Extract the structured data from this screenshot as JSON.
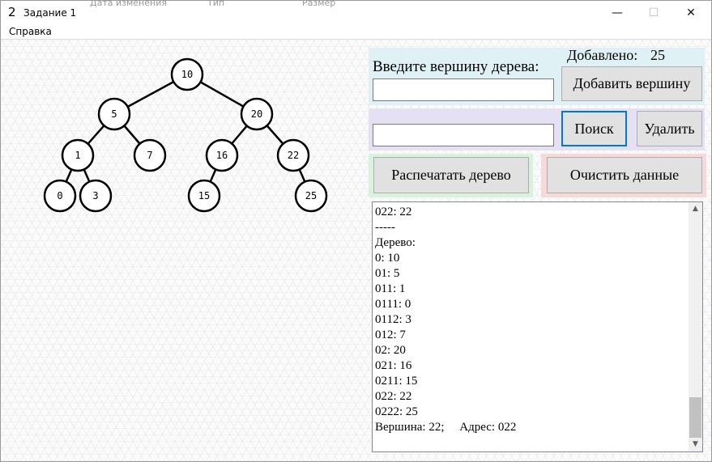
{
  "window": {
    "app_icon_glyph": "2",
    "title": "Задание 1",
    "background_header_text": [
      "Дата изменения",
      "Тип",
      "Размер"
    ],
    "minimize_glyph": "—",
    "maximize_glyph": "☐",
    "close_glyph": "✕"
  },
  "menu": {
    "items": [
      "Справка"
    ]
  },
  "tree": {
    "nodes": [
      {
        "id": "n10",
        "label": "10"
      },
      {
        "id": "n5",
        "label": "5"
      },
      {
        "id": "n20",
        "label": "20"
      },
      {
        "id": "n1",
        "label": "1"
      },
      {
        "id": "n7",
        "label": "7"
      },
      {
        "id": "n16",
        "label": "16"
      },
      {
        "id": "n22",
        "label": "22"
      },
      {
        "id": "n0",
        "label": "0"
      },
      {
        "id": "n3",
        "label": "3"
      },
      {
        "id": "n15",
        "label": "15"
      },
      {
        "id": "n25",
        "label": "25"
      }
    ],
    "edges": [
      [
        "n10",
        "n5"
      ],
      [
        "n10",
        "n20"
      ],
      [
        "n5",
        "n1"
      ],
      [
        "n5",
        "n7"
      ],
      [
        "n20",
        "n16"
      ],
      [
        "n20",
        "n22"
      ],
      [
        "n1",
        "n0"
      ],
      [
        "n1",
        "n3"
      ],
      [
        "n16",
        "n15"
      ],
      [
        "n22",
        "n25"
      ]
    ]
  },
  "add_panel": {
    "prompt_label": "Введите вершину дерева:",
    "added_label": "Добавлено:",
    "added_count": "25",
    "input_value": "",
    "add_button": "Добавить вершину",
    "color": "#dff1f5"
  },
  "search_panel": {
    "input_value": "",
    "search_button": "Поиск",
    "delete_button": "Удалить",
    "color": "#e6e0f5"
  },
  "print_panel": {
    "print_button": "Распечатать дерево",
    "color": "#d9f2df"
  },
  "clear_panel": {
    "clear_button": "Очистить данные",
    "color": "#f7d9d9"
  },
  "output": {
    "lines": [
      "022: 22",
      "-----",
      "Дерево:",
      "0: 10",
      "01: 5",
      "011: 1",
      "0111: 0",
      "0112: 3",
      "012: 7",
      "02: 20",
      "021: 16",
      "0211: 15",
      "022: 22",
      "0222: 25",
      "Вершина: 22;     Адрес: 022"
    ],
    "scroll_up_glyph": "▲",
    "scroll_down_glyph": "▼"
  }
}
